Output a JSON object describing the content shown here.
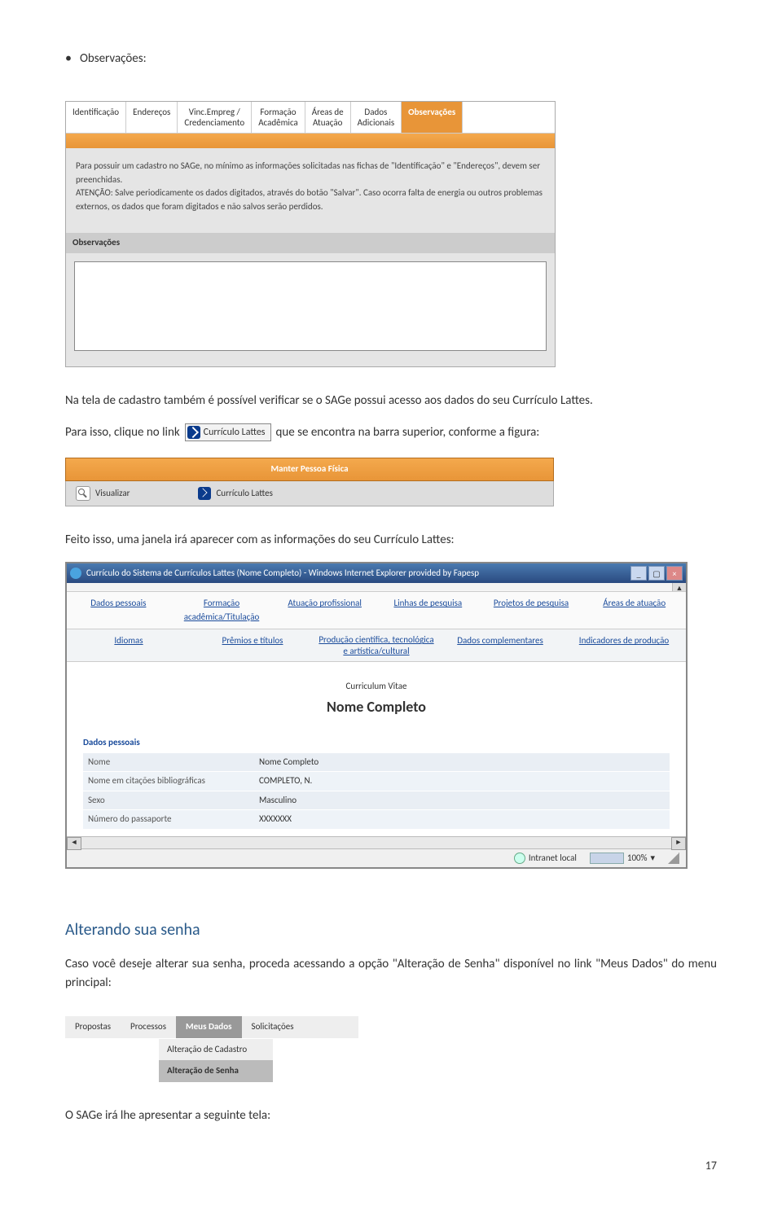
{
  "bullet": {
    "label": "Observações:"
  },
  "ss1": {
    "tabs": [
      {
        "label": "Identificação"
      },
      {
        "label": "Endereços"
      },
      {
        "label": "Vinc.Empreg /\nCredenciamento"
      },
      {
        "label": "Formação\nAcadêmica"
      },
      {
        "label": "Áreas de\nAtuação"
      },
      {
        "label": "Dados\nAdicionais"
      },
      {
        "label": "Observações"
      }
    ],
    "body_line1": "Para possuir um cadastro no SAGe, no mínimo as informações solicitadas nas fichas de \"Identificação\" e \"Endereços\", devem ser preenchidas.",
    "body_line2": "ATENÇÃO: Salve periodicamente os dados digitados, através do botão \"Salvar\". Caso ocorra falta de energia ou outros problemas externos, os dados que foram digitados e não salvos serão perdidos.",
    "section": "Observações"
  },
  "para1": "Na tela de cadastro também é possível verificar se o SAGe possui acesso aos dados do seu Currículo Lattes.",
  "para2": {
    "pre": "Para isso, clique no link",
    "btn": "Currículo Lattes",
    "post": "que se encontra na barra superior, conforme a figura:"
  },
  "ss2": {
    "header": "Manter Pessoa Física",
    "visualizar": "Visualizar",
    "lattes": "Currículo Lattes"
  },
  "para3": "Feito isso, uma janela irá aparecer com as informações do seu Currículo Lattes:",
  "ss3": {
    "window_title": "Currículo do Sistema de Currículos Lattes (Nome Completo) - Windows Internet Explorer provided by Fapesp",
    "nav1": [
      "Dados pessoais",
      "Formação acadêmica/Titulação",
      "Atuação profissional",
      "Linhas de pesquisa",
      "Projetos de pesquisa",
      "Áreas de atuação"
    ],
    "nav2": [
      "Idiomas",
      "Prêmios e títulos",
      "Produção científica, tecnológica e artística/cultural",
      "Dados complementares",
      "Indicadores de produção"
    ],
    "cv_title": "Curriculum Vitae",
    "cv_name": "Nome Completo",
    "section": "Dados pessoais",
    "rows": [
      {
        "label": "Nome",
        "value": "Nome Completo"
      },
      {
        "label": "Nome em citações bibliográficas",
        "value": "COMPLETO, N."
      },
      {
        "label": "Sexo",
        "value": "Masculino"
      },
      {
        "label": "Número do passaporte",
        "value": "XXXXXXX"
      }
    ],
    "status_zone": "Intranet local",
    "status_zoom": "100%"
  },
  "heading2": "Alterando sua senha",
  "para4": "Caso você deseje alterar sua senha, proceda acessando a opção \"Alteração de Senha\" disponível no link \"Meus Dados\" do menu principal:",
  "ss4": {
    "menu": [
      "Propostas",
      "Processos",
      "Meus Dados",
      "Solicitações"
    ],
    "dropdown": [
      "Alteração de Cadastro",
      "Alteração de Senha"
    ]
  },
  "para5": "O SAGe irá lhe apresentar a seguinte tela:",
  "page_number": "17"
}
